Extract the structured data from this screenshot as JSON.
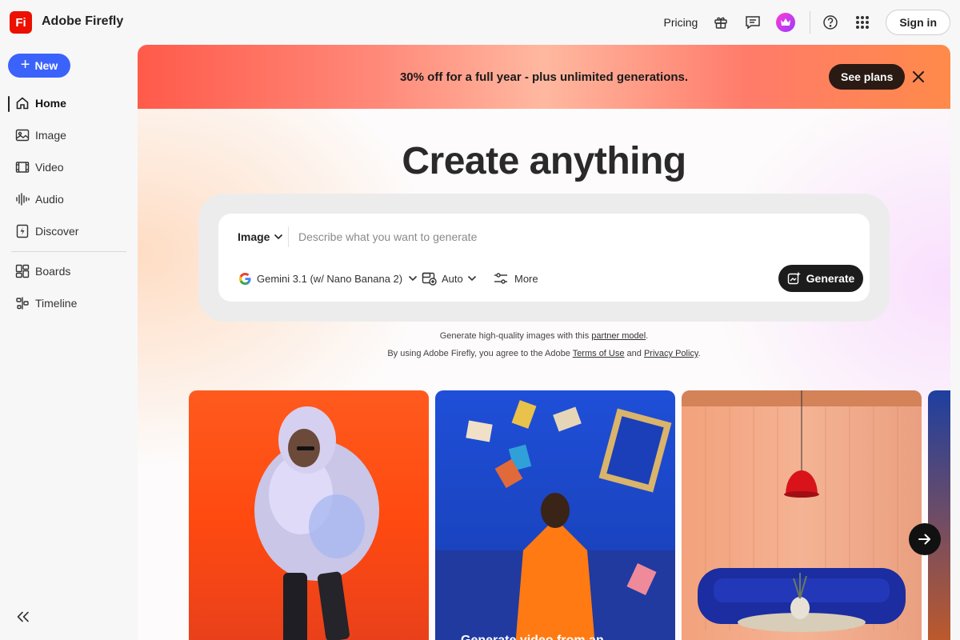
{
  "app": {
    "logo_text": "Fi",
    "title": "Adobe Firefly",
    "brand_color": "#eb1000"
  },
  "topbar": {
    "pricing_label": "Pricing",
    "icons": [
      "gift-icon",
      "chat-icon",
      "premium-crown-icon",
      "help-icon",
      "apps-grid-icon"
    ],
    "signin_label": "Sign in"
  },
  "sidebar": {
    "new_label": "New",
    "accent_color": "#3b63fb",
    "items": [
      {
        "label": "Home",
        "icon": "home-icon",
        "active": true
      },
      {
        "label": "Image",
        "icon": "image-icon"
      },
      {
        "label": "Video",
        "icon": "video-icon"
      },
      {
        "label": "Audio",
        "icon": "audio-icon"
      },
      {
        "label": "Discover",
        "icon": "discover-icon"
      },
      {
        "label": "Boards",
        "icon": "boards-icon"
      },
      {
        "label": "Timeline",
        "icon": "timeline-icon"
      }
    ]
  },
  "promo": {
    "text": "30% off for a full year - plus unlimited generations.",
    "cta_label": "See plans"
  },
  "hero": {
    "title": "Create anything",
    "type_selector": "Image",
    "prompt_placeholder": "Describe what you want to generate",
    "model_selector": "Gemini 3.1 (w/ Nano Banana 2)",
    "ratio_selector": "Auto",
    "more_label": "More",
    "generate_label": "Generate"
  },
  "legal": {
    "line1_prefix": "Generate high-quality images with this ",
    "line1_link": "partner model",
    "line1_suffix": ".",
    "line2_prefix": "By using Adobe Firefly, you agree to the Adobe ",
    "terms_link": "Terms of Use",
    "and_text": " and ",
    "privacy_link": "Privacy Policy",
    "line2_suffix": "."
  },
  "gallery": {
    "cards": [
      {
        "caption": ""
      },
      {
        "caption": "Generate video from an"
      },
      {
        "caption": ""
      },
      {
        "caption": ""
      }
    ]
  }
}
